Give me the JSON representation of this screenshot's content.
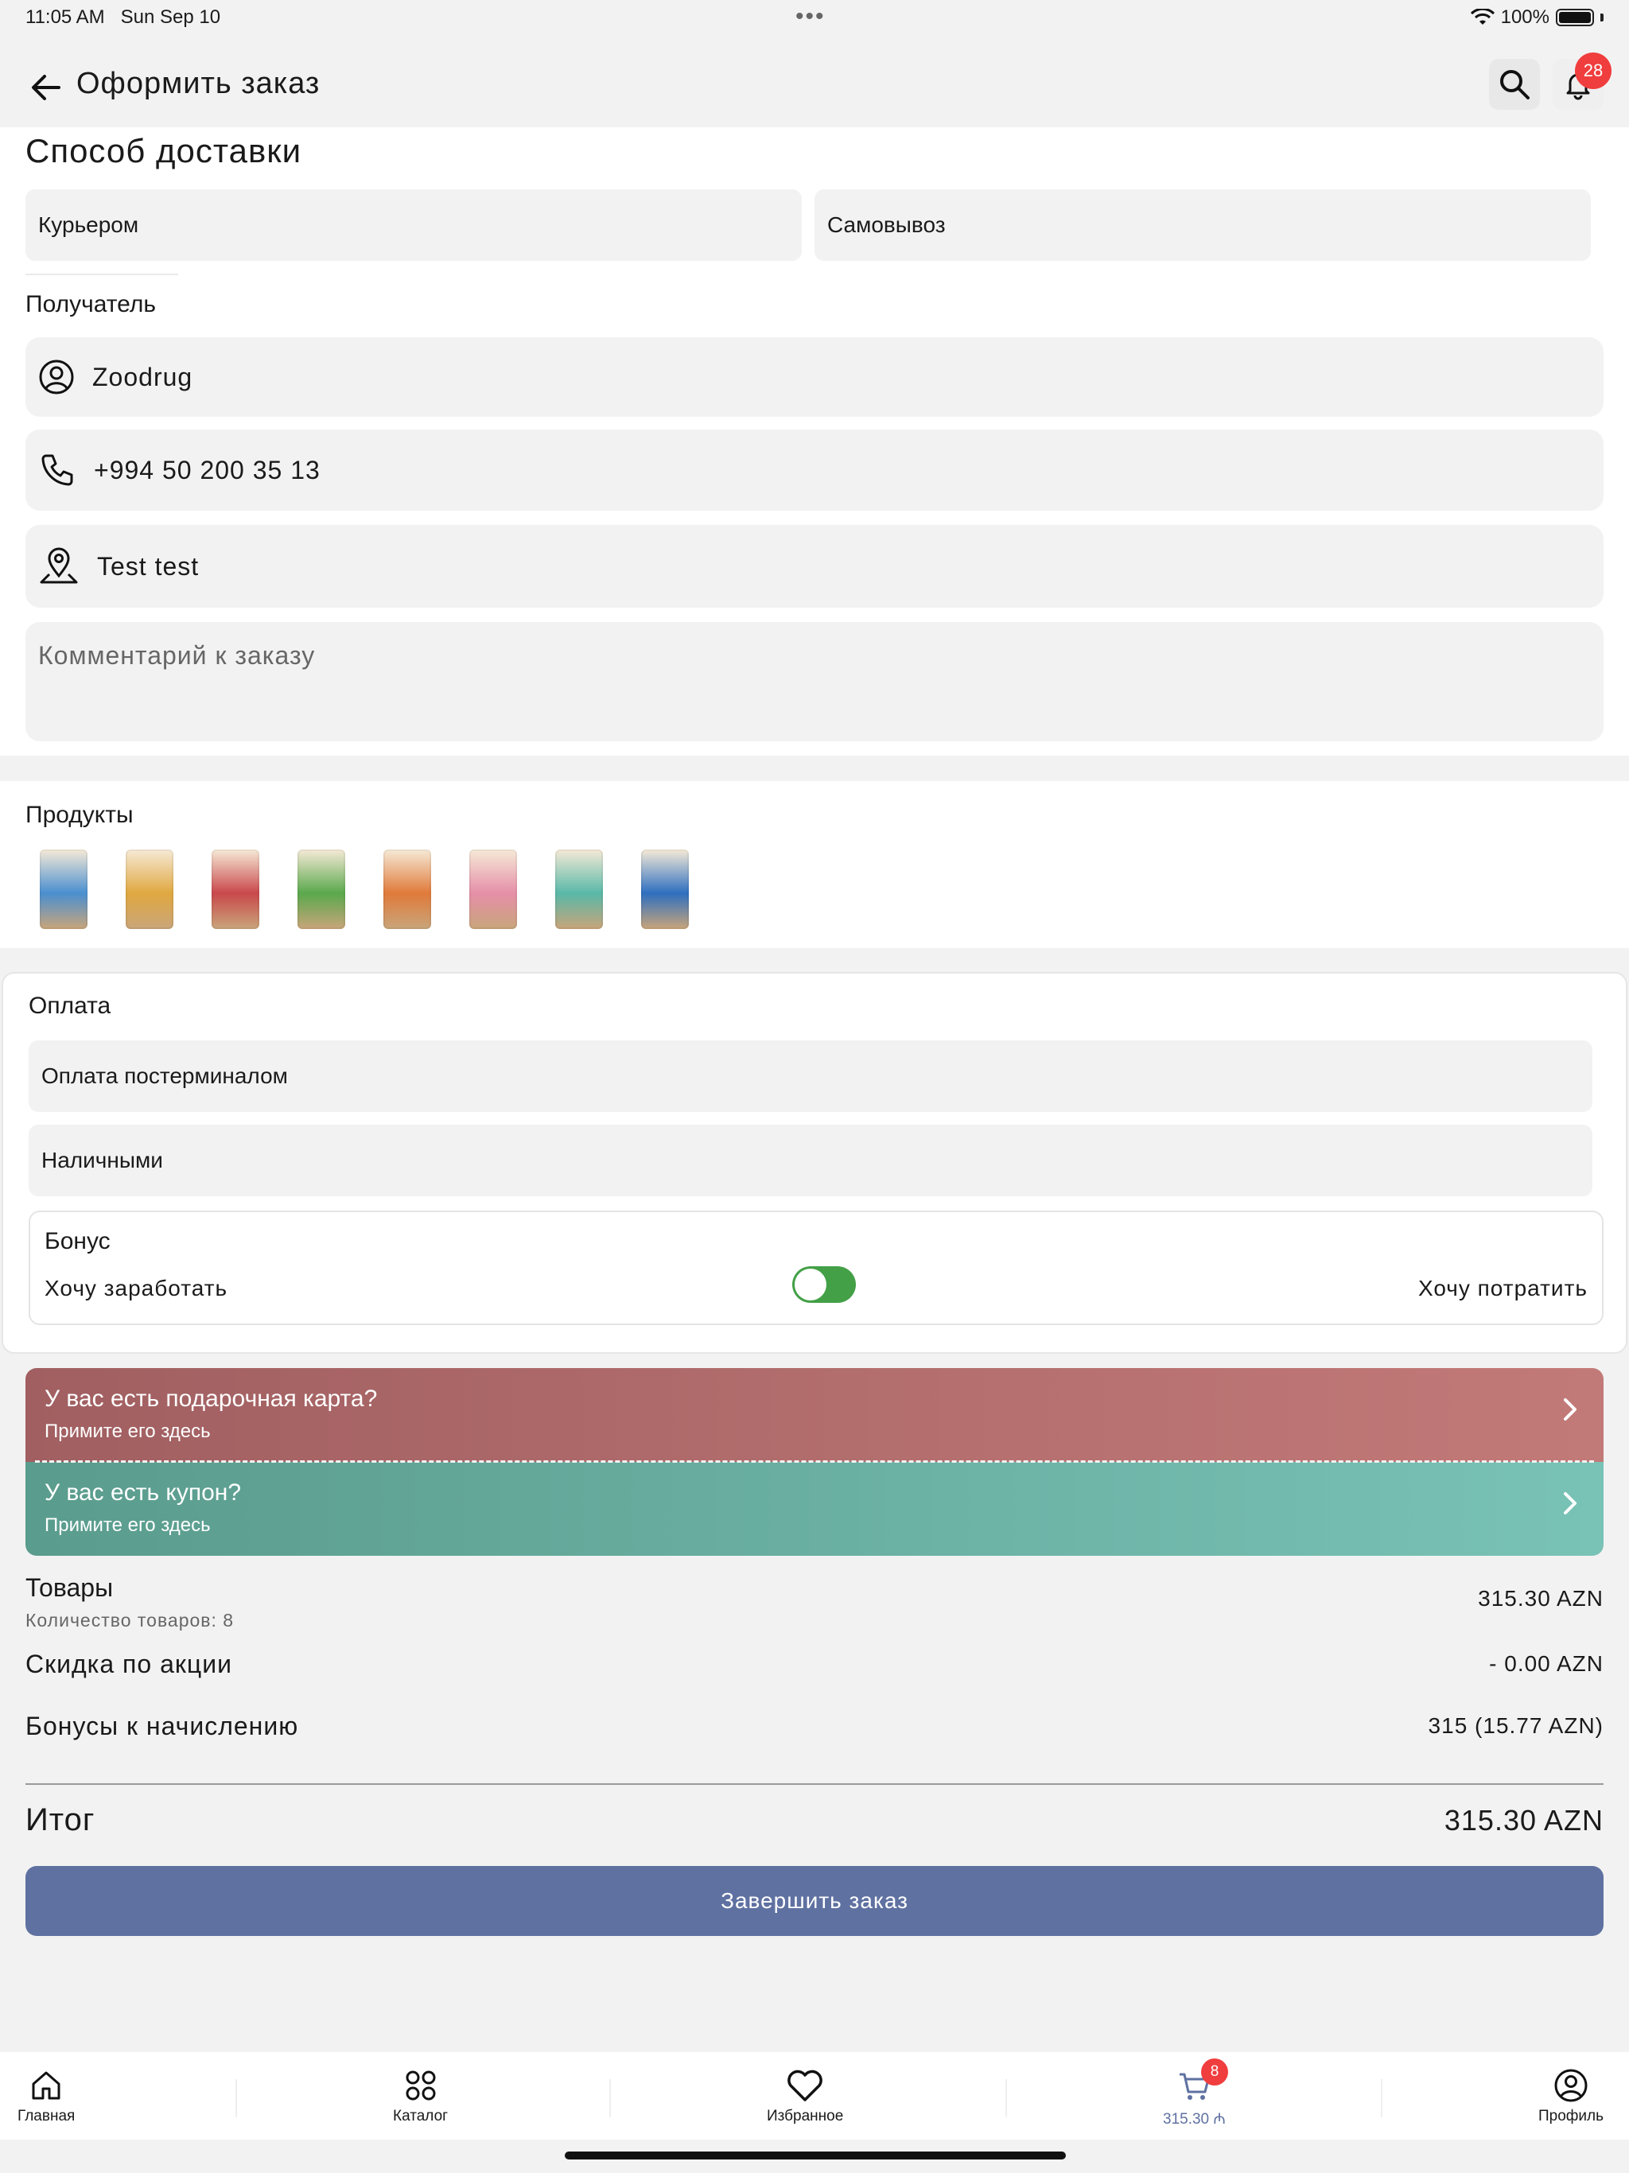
{
  "status": {
    "time": "11:05 AM",
    "date": "Sun Sep 10",
    "battery": "100%"
  },
  "header": {
    "title": "Оформить заказ",
    "notifications_count": "28"
  },
  "delivery": {
    "title": "Способ доставки",
    "options": [
      "Курьером",
      "Самовывоз"
    ]
  },
  "recipient": {
    "title": "Получатель",
    "name": "Zoodrug",
    "phone": "+994 50 200 35 13",
    "address": "Test test",
    "comment_placeholder": "Комментарий к заказу"
  },
  "products": {
    "title": "Продукты",
    "items": [
      {
        "color": "#4a8fd0"
      },
      {
        "color": "#e0a840"
      },
      {
        "color": "#c9484b"
      },
      {
        "color": "#5aa84c"
      },
      {
        "color": "#e07a3a"
      },
      {
        "color": "#e58fa8"
      },
      {
        "color": "#59b8a8"
      },
      {
        "color": "#2e6fc0"
      }
    ]
  },
  "payment": {
    "title": "Оплата",
    "options": [
      "Оплата постерминалом",
      "Наличными"
    ],
    "bonus": {
      "title": "Бонус",
      "earn": "Хочу заработать",
      "spend": "Хочу потратить"
    }
  },
  "promo": {
    "gift_title": "У вас есть подарочная карта?",
    "gift_sub": "Примите его здесь",
    "coupon_title": "У вас есть купон?",
    "coupon_sub": "Примите его здесь"
  },
  "summary": {
    "goods_label": "Товары",
    "goods_count": "Количество товаров: 8",
    "goods_value": "315.30 AZN",
    "discount_label": "Скидка по акции",
    "discount_value": "- 0.00 AZN",
    "bonus_label": "Бонусы к начислению",
    "bonus_value": "315 (15.77 AZN)",
    "total_label": "Итог",
    "total_value": "315.30 AZN"
  },
  "cta": {
    "label": "Завершить заказ"
  },
  "tabbar": {
    "home": "Главная",
    "catalog": "Каталог",
    "favorites": "Избранное",
    "cart": "315.30 ₼",
    "cart_badge": "8",
    "profile": "Профиль"
  },
  "colors": {
    "accent": "#5f71a1",
    "gift": "#a45f62",
    "coupon": "#62a595",
    "badge": "#f03d3d"
  }
}
